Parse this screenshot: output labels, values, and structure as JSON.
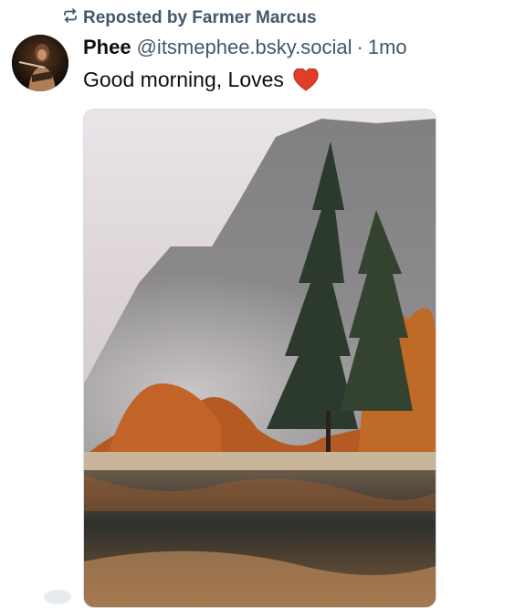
{
  "repost": {
    "icon": "repost-icon",
    "text": "Reposted by Farmer Marcus"
  },
  "post": {
    "author_name": "Phee",
    "handle": "@itsmephee.bsky.social",
    "separator": "·",
    "time": "1mo",
    "text": "Good morning, Loves",
    "emoji": "heart-icon",
    "avatar": "avatar-image",
    "image": "landscape-photo"
  },
  "colors": {
    "muted": "#42576c",
    "text": "#0b0f14",
    "heart": "#e23d28"
  }
}
